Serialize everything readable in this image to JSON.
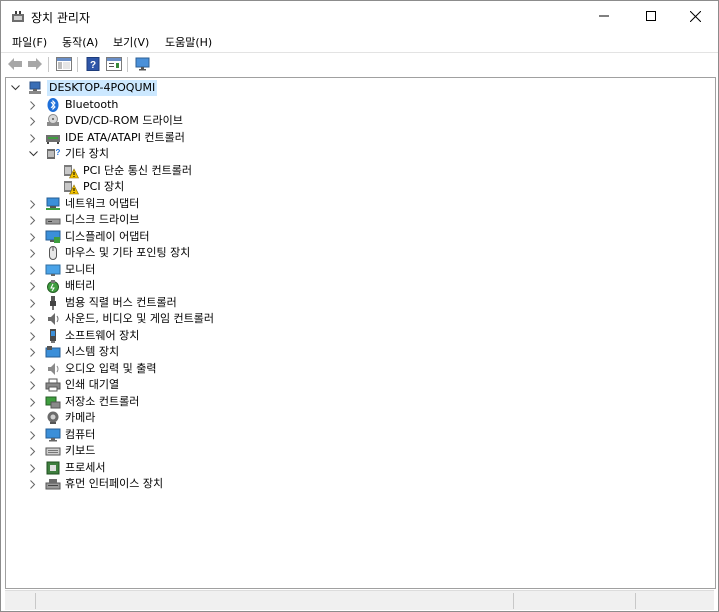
{
  "window": {
    "title": "장치 관리자"
  },
  "menu": [
    "파일(F)",
    "동작(A)",
    "보기(V)",
    "도움말(H)"
  ],
  "tree": {
    "root": "DESKTOP-4POQUMI",
    "items": [
      {
        "label": "Bluetooth",
        "icon": "bluetooth-icon"
      },
      {
        "label": "DVD/CD-ROM 드라이브",
        "icon": "dvd-drive-icon"
      },
      {
        "label": "IDE ATA/ATAPI 컨트롤러",
        "icon": "ide-controller-icon"
      },
      {
        "label": "기타 장치",
        "icon": "other-devices-icon",
        "expanded": true,
        "children": [
          {
            "label": "PCI 단순 통신 컨트롤러",
            "icon": "warning-device-icon"
          },
          {
            "label": "PCI 장치",
            "icon": "warning-device-icon"
          }
        ]
      },
      {
        "label": "네트워크 어댑터",
        "icon": "network-adapter-icon"
      },
      {
        "label": "디스크 드라이브",
        "icon": "disk-drive-icon"
      },
      {
        "label": "디스플레이 어댑터",
        "icon": "display-adapter-icon"
      },
      {
        "label": "마우스 및 기타 포인팅 장치",
        "icon": "mouse-icon"
      },
      {
        "label": "모니터",
        "icon": "monitor-icon"
      },
      {
        "label": "배터리",
        "icon": "battery-icon"
      },
      {
        "label": "범용 직렬 버스 컨트롤러",
        "icon": "usb-icon"
      },
      {
        "label": "사운드, 비디오 및 게임 컨트롤러",
        "icon": "sound-icon"
      },
      {
        "label": "소프트웨어 장치",
        "icon": "software-device-icon"
      },
      {
        "label": "시스템 장치",
        "icon": "system-device-icon"
      },
      {
        "label": "오디오 입력 및 출력",
        "icon": "audio-io-icon"
      },
      {
        "label": "인쇄 대기열",
        "icon": "printer-icon"
      },
      {
        "label": "저장소 컨트롤러",
        "icon": "storage-controller-icon"
      },
      {
        "label": "카메라",
        "icon": "camera-icon"
      },
      {
        "label": "컴퓨터",
        "icon": "computer-icon"
      },
      {
        "label": "키보드",
        "icon": "keyboard-icon"
      },
      {
        "label": "프로세서",
        "icon": "processor-icon"
      },
      {
        "label": "휴먼 인터페이스 장치",
        "icon": "hid-icon"
      }
    ]
  }
}
